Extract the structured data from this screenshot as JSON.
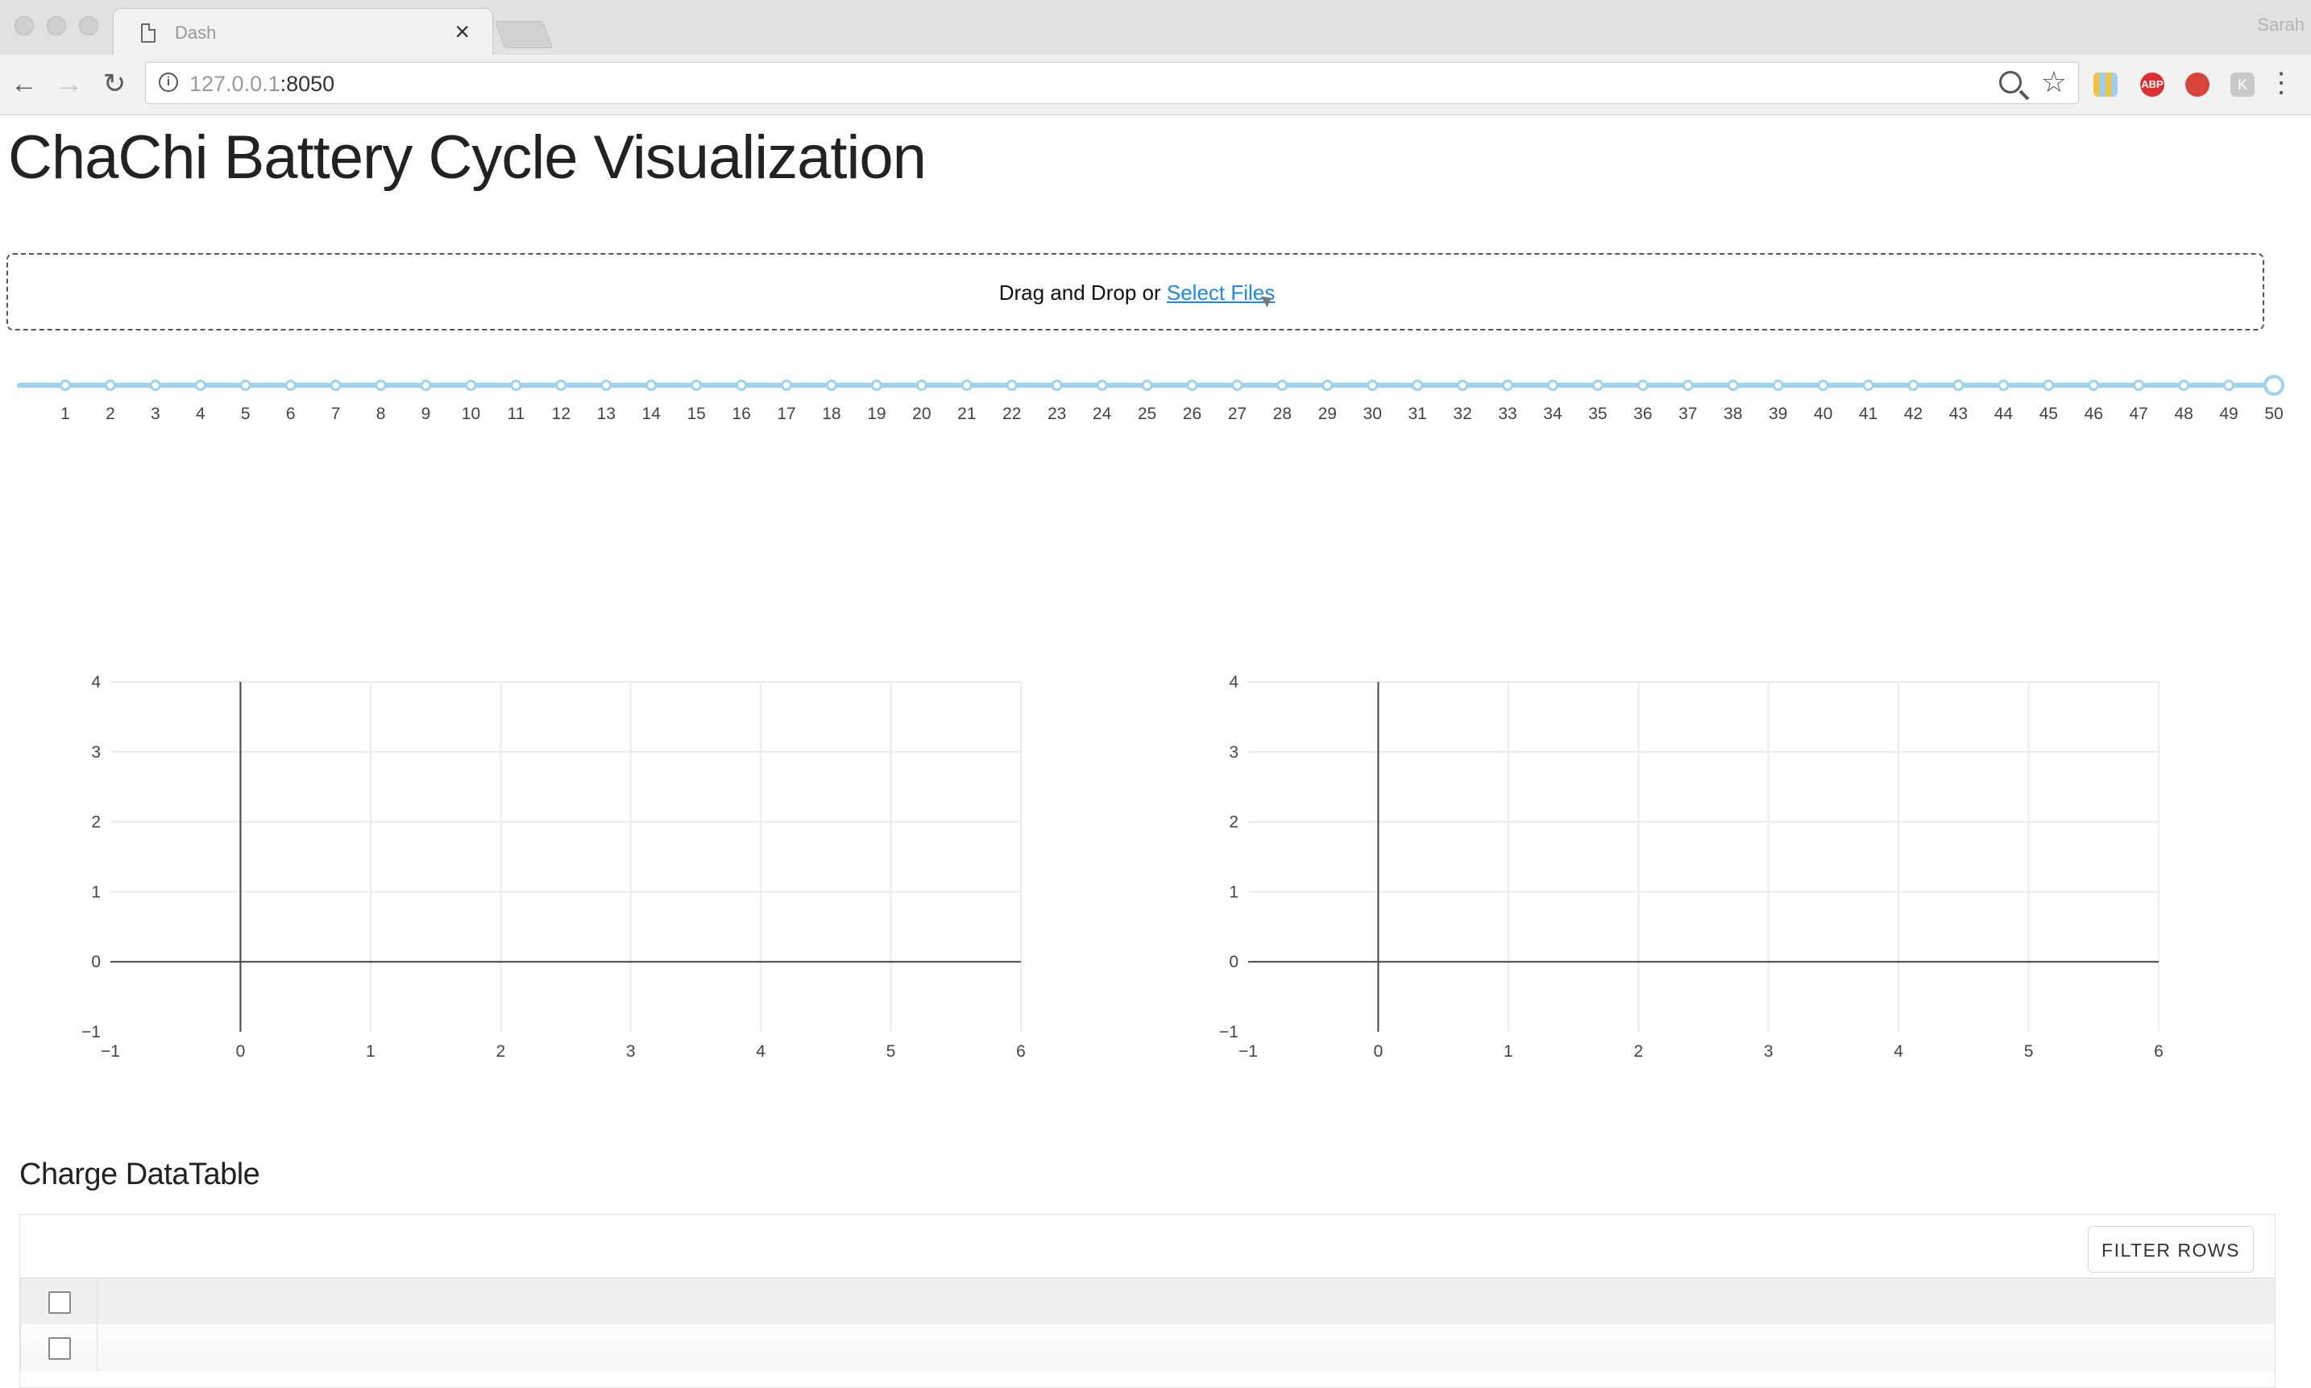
{
  "browser": {
    "tab_title": "Dash",
    "tab_close": "×",
    "profile_name": "Sarah",
    "url_host": "127.0.0.1",
    "url_port": ":8050",
    "info_glyph": "i",
    "abp_label": "ABP",
    "k_label": "K",
    "icons": [
      "document-icon",
      "close-icon",
      "back-icon",
      "forward-icon",
      "reload-icon",
      "info-icon",
      "zoom-icon",
      "star-icon",
      "menu-icon"
    ]
  },
  "page": {
    "title": "ChaChi Battery Cycle Visualization",
    "upload": {
      "text": "Drag and Drop or ",
      "link": "Select Files"
    },
    "slider": {
      "min": 1,
      "max": 50,
      "value": 50,
      "marks": [
        "1",
        "2",
        "3",
        "4",
        "5",
        "6",
        "7",
        "8",
        "9",
        "10",
        "11",
        "12",
        "13",
        "14",
        "15",
        "16",
        "17",
        "18",
        "19",
        "20",
        "21",
        "22",
        "23",
        "24",
        "25",
        "26",
        "27",
        "28",
        "29",
        "30",
        "31",
        "32",
        "33",
        "34",
        "35",
        "36",
        "37",
        "38",
        "39",
        "40",
        "41",
        "42",
        "43",
        "44",
        "45",
        "46",
        "47",
        "48",
        "49",
        "50"
      ],
      "color": "#9ad4f0"
    },
    "table": {
      "title": "Charge DataTable",
      "filter_button": "FILTER ROWS"
    }
  },
  "chart_data": [
    {
      "type": "scatter",
      "title": "",
      "xlabel": "",
      "ylabel": "",
      "series": [],
      "xlim": [
        -1,
        6
      ],
      "ylim": [
        -1,
        4
      ],
      "xticks": [
        "−1",
        "0",
        "1",
        "2",
        "3",
        "4",
        "5",
        "6"
      ],
      "yticks": [
        "−1",
        "0",
        "1",
        "2",
        "3",
        "4"
      ],
      "grid": true
    },
    {
      "type": "scatter",
      "title": "",
      "xlabel": "",
      "ylabel": "",
      "series": [],
      "xlim": [
        -1,
        6
      ],
      "ylim": [
        -1,
        4
      ],
      "xticks": [
        "−1",
        "0",
        "1",
        "2",
        "3",
        "4",
        "5",
        "6"
      ],
      "yticks": [
        "−1",
        "0",
        "1",
        "2",
        "3",
        "4"
      ],
      "grid": true
    }
  ]
}
